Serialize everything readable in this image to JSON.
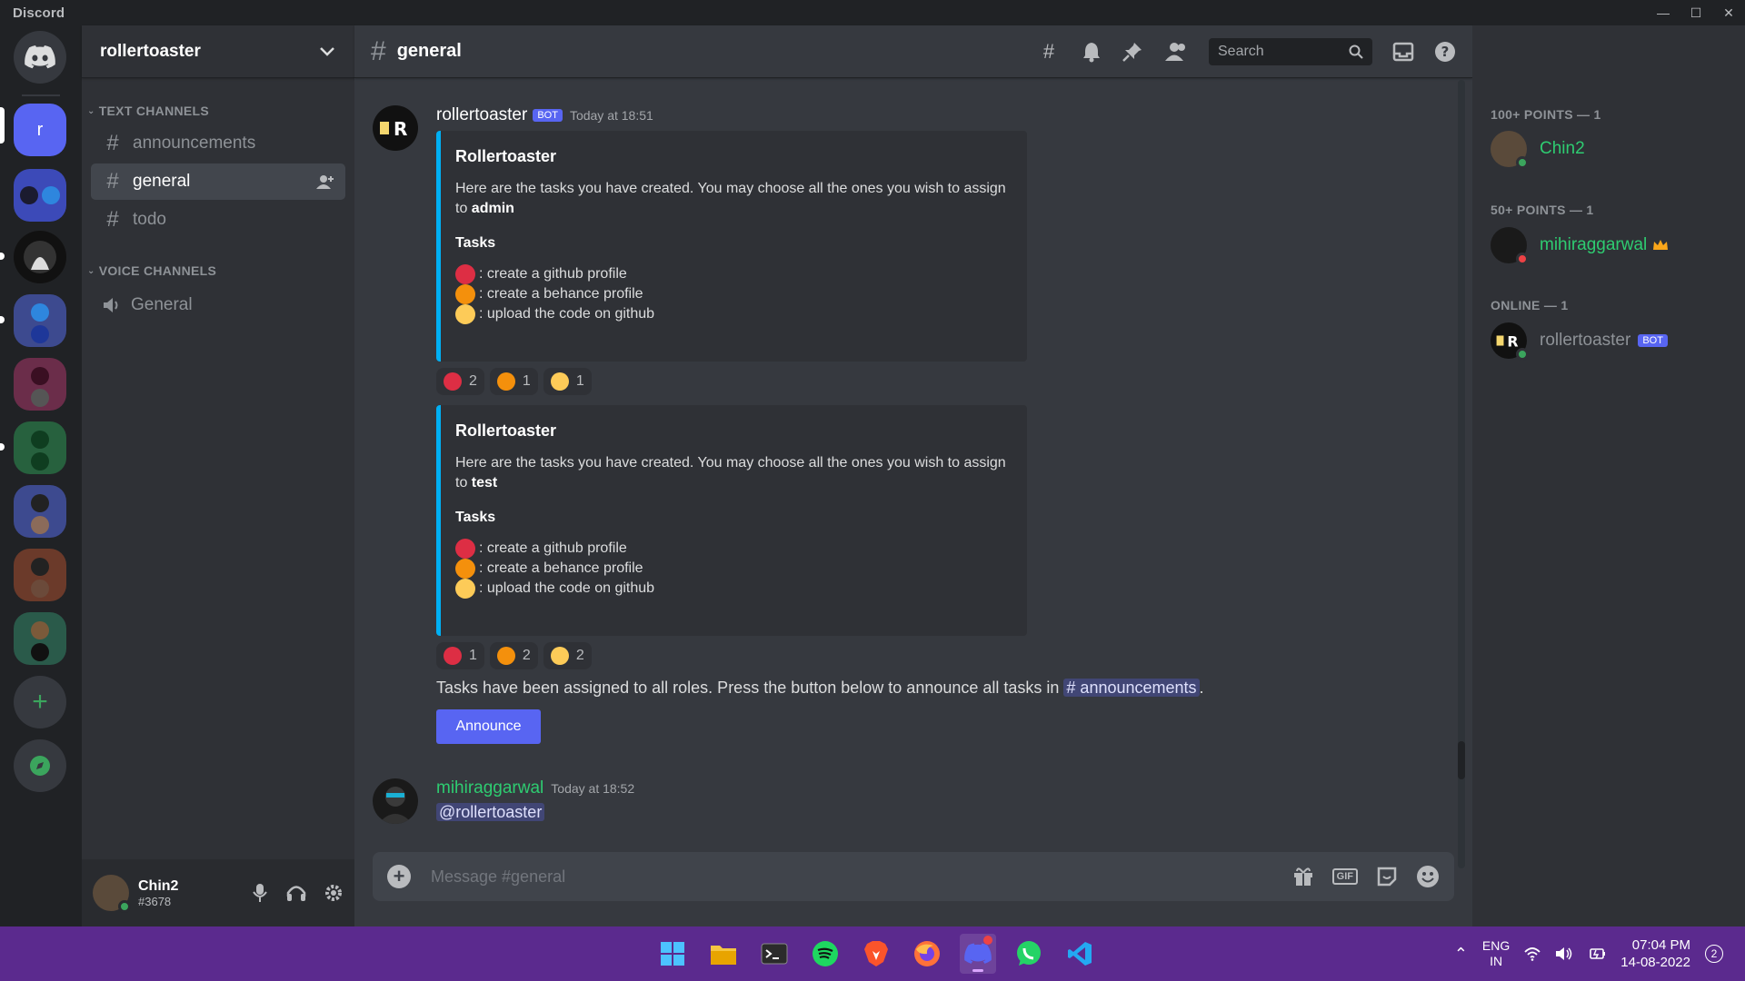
{
  "window": {
    "app_name": "Discord",
    "controls": [
      "—",
      "☐",
      "✕"
    ]
  },
  "rail": {
    "home_label": "Discord home",
    "active_server_initial": "r",
    "add_server": "+",
    "explore": "compass"
  },
  "sidebar": {
    "server_name": "rollertoaster",
    "text_category": "TEXT CHANNELS",
    "voice_category": "VOICE CHANNELS",
    "text_channels": [
      "announcements",
      "general",
      "todo"
    ],
    "voice_channels": [
      "General"
    ],
    "active_channel": "general"
  },
  "user": {
    "name": "Chin2",
    "tag": "#3678"
  },
  "header": {
    "channel": "general",
    "search_placeholder": "Search"
  },
  "messages": {
    "m1": {
      "author": "rollertoaster",
      "bot_tag": "BOT",
      "time": "Today at 18:51",
      "embed1": {
        "title": "Rollertoaster",
        "desc": "Here are the tasks you have created. You may choose all the ones you wish to assign to ",
        "role": "admin",
        "heading": "Tasks",
        "tasks": [
          ": create a github profile",
          ": create a behance profile",
          ": upload the code on github"
        ],
        "reactions": [
          "2",
          "1",
          "1"
        ]
      },
      "embed2": {
        "title": "Rollertoaster",
        "desc": "Here are the tasks you have created. You may choose all the ones you wish to assign to ",
        "role": "test",
        "heading": "Tasks",
        "tasks": [
          ": create a github profile",
          ": create a behance profile",
          ": upload the code on github"
        ],
        "reactions": [
          "1",
          "2",
          "2"
        ]
      },
      "assigned_text": "Tasks have been assigned to all roles. Press the button below to announce all tasks in ",
      "channel_mention": "# announcements",
      "assigned_end": ".",
      "button": "Announce"
    },
    "m2": {
      "author": "mihiraggarwal",
      "time": "Today at 18:52",
      "mention": "@rollertoaster"
    }
  },
  "composer": {
    "placeholder": "Message #general",
    "gif": "GIF"
  },
  "members": {
    "groups": [
      {
        "heading": "100+ POINTS — 1",
        "name": "Chin2",
        "color": "#2ecc71"
      },
      {
        "heading": "50+ POINTS — 1",
        "name": "mihiraggarwal",
        "color": "#2ecc71"
      },
      {
        "heading": "ONLINE — 1",
        "name": "rollertoaster",
        "color": "#8e9297",
        "bot": "BOT"
      }
    ]
  },
  "taskbar": {
    "lang1": "ENG",
    "lang2": "IN",
    "time": "07:04 PM",
    "date": "14-08-2022",
    "notif": "2"
  },
  "colors": {
    "blurple": "#5865f2",
    "green": "#2ecc71",
    "embed_border": "#00b0f4"
  }
}
